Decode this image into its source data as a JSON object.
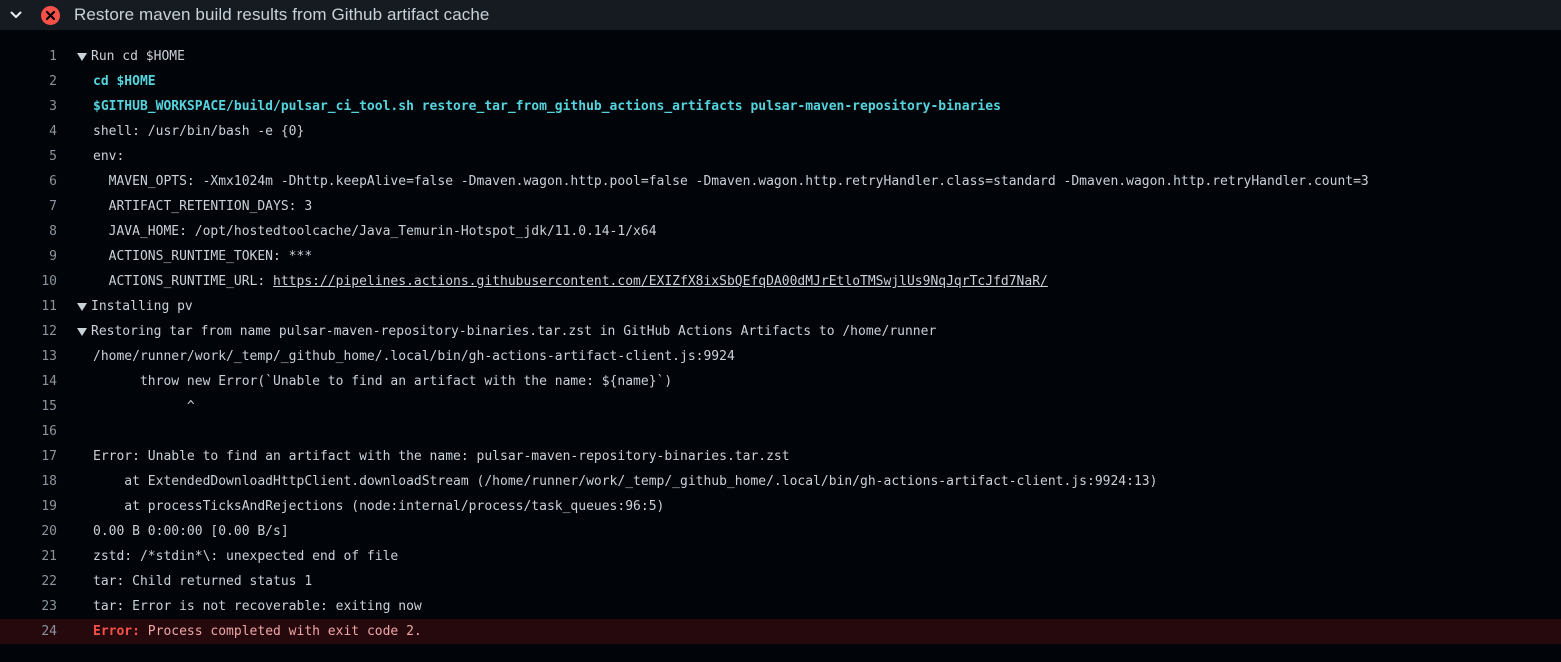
{
  "header": {
    "title": "Restore maven build results from Github artifact cache",
    "status_icon": "x-circle-icon",
    "expand_icon": "chevron-down-icon"
  },
  "colors": {
    "background": "#010409",
    "header_bg": "#161b22",
    "command": "#56d4dd",
    "error": "#f85149",
    "error_row_bg": "#25090d",
    "line_number": "#8b949e"
  },
  "log": {
    "lines": [
      {
        "num": "1",
        "text": "Run cd $HOME"
      },
      {
        "num": "2",
        "text": "cd $HOME"
      },
      {
        "num": "3",
        "text": "$GITHUB_WORKSPACE/build/pulsar_ci_tool.sh restore_tar_from_github_actions_artifacts pulsar-maven-repository-binaries"
      },
      {
        "num": "4",
        "text": "shell: /usr/bin/bash -e {0}"
      },
      {
        "num": "5",
        "text": "env:"
      },
      {
        "num": "6",
        "text": "  MAVEN_OPTS: -Xmx1024m -Dhttp.keepAlive=false -Dmaven.wagon.http.pool=false -Dmaven.wagon.http.retryHandler.class=standard -Dmaven.wagon.http.retryHandler.count=3"
      },
      {
        "num": "7",
        "text": "  ARTIFACT_RETENTION_DAYS: 3"
      },
      {
        "num": "8",
        "text": "  JAVA_HOME: /opt/hostedtoolcache/Java_Temurin-Hotspot_jdk/11.0.14-1/x64"
      },
      {
        "num": "9",
        "text": "  ACTIONS_RUNTIME_TOKEN: ***"
      },
      {
        "num": "10",
        "text": "  ACTIONS_RUNTIME_URL: ",
        "link": "https://pipelines.actions.githubusercontent.com/EXIZfX8ixSbQEfqDA00dMJrEtloTMSwjlUs9NqJqrTcJfd7NaR/"
      },
      {
        "num": "11",
        "text": "Installing pv"
      },
      {
        "num": "12",
        "text": "Restoring tar from name pulsar-maven-repository-binaries.tar.zst in GitHub Actions Artifacts to /home/runner"
      },
      {
        "num": "13",
        "text": "/home/runner/work/_temp/_github_home/.local/bin/gh-actions-artifact-client.js:9924"
      },
      {
        "num": "14",
        "text": "      throw new Error(`Unable to find an artifact with the name: ${name}`)"
      },
      {
        "num": "15",
        "text": "            ^"
      },
      {
        "num": "16",
        "text": ""
      },
      {
        "num": "17",
        "text": "Error: Unable to find an artifact with the name: pulsar-maven-repository-binaries.tar.zst"
      },
      {
        "num": "18",
        "text": "    at ExtendedDownloadHttpClient.downloadStream (/home/runner/work/_temp/_github_home/.local/bin/gh-actions-artifact-client.js:9924:13)"
      },
      {
        "num": "19",
        "text": "    at processTicksAndRejections (node:internal/process/task_queues:96:5)"
      },
      {
        "num": "20",
        "text": "0.00 B 0:00:00 [0.00 B/s]"
      },
      {
        "num": "21",
        "text": "zstd: /*stdin*\\: unexpected end of file"
      },
      {
        "num": "22",
        "text": "tar: Child returned status 1"
      },
      {
        "num": "23",
        "text": "tar: Error is not recoverable: exiting now"
      },
      {
        "num": "24",
        "label": "Error:",
        "text": " Process completed with exit code 2."
      }
    ]
  }
}
